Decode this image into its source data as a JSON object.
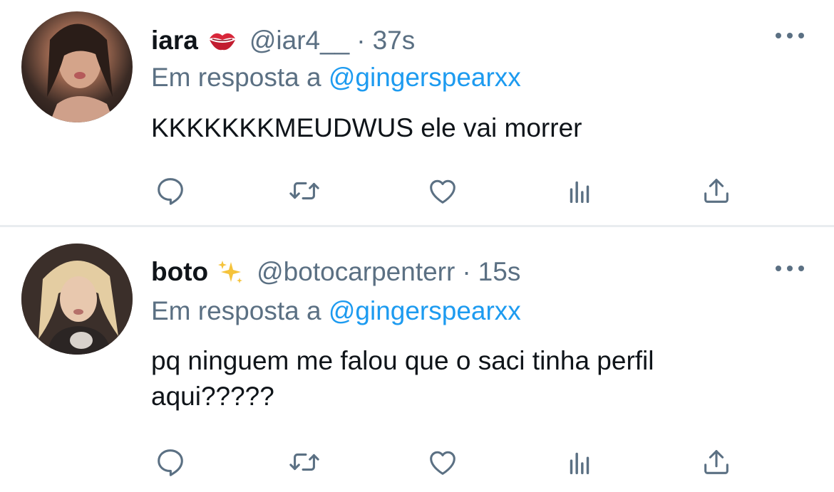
{
  "tweets": [
    {
      "name": "iara",
      "emoji": "💋",
      "handle": "@iar4__",
      "separator": "·",
      "time": "37s",
      "reply_prefix": "Em resposta a",
      "reply_mention": "@gingerspearxx",
      "text": "KKKKKKKMEUDWUS ele vai morrer",
      "actions": [
        "reply-icon",
        "retweet-icon",
        "like-icon",
        "analytics-icon",
        "share-icon"
      ]
    },
    {
      "name": "boto",
      "emoji": "✨",
      "handle": "@botocarpenterr",
      "separator": "·",
      "time": "15s",
      "reply_prefix": "Em resposta a",
      "reply_mention": "@gingerspearxx",
      "text": "pq ninguem me falou que o saci tinha perfil aqui?????",
      "actions": [
        "reply-icon",
        "retweet-icon",
        "like-icon",
        "analytics-icon",
        "share-icon"
      ]
    }
  ],
  "colors": {
    "text": "#0f1419",
    "secondary": "#5b7083",
    "link": "#1d9bf0",
    "divider": "#e9ecef"
  }
}
